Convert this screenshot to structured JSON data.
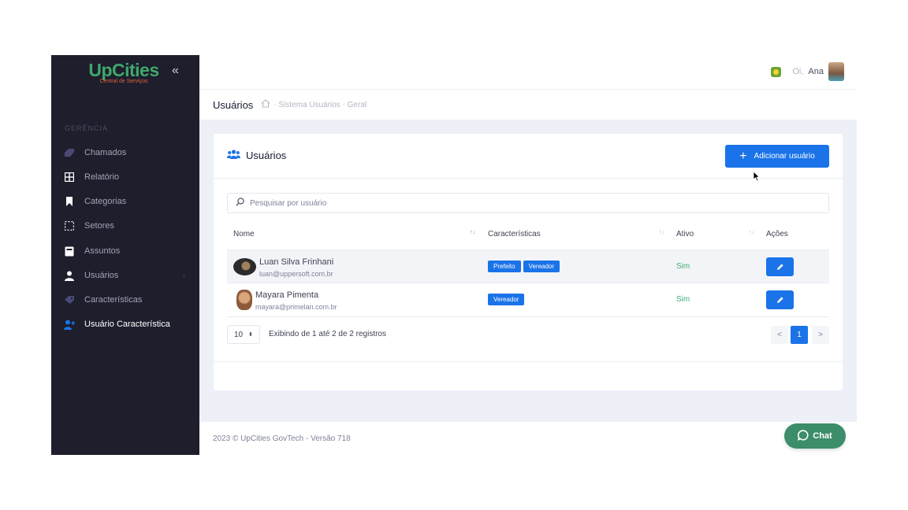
{
  "brand": {
    "title": "UpCities",
    "subtitle": "Central de Serviços"
  },
  "sidebar": {
    "section": "GERÊNCIA",
    "items": [
      {
        "label": "Chamados",
        "icon": "ticket-icon"
      },
      {
        "label": "Relatório",
        "icon": "grid-icon"
      },
      {
        "label": "Categorias",
        "icon": "bookmark-icon"
      },
      {
        "label": "Setores",
        "icon": "dotted-square-icon"
      },
      {
        "label": "Assuntos",
        "icon": "book-icon"
      },
      {
        "label": "Usuários",
        "icon": "user-icon",
        "arrow": "›"
      },
      {
        "label": "Características",
        "icon": "tag-icon"
      },
      {
        "label": "Usuário Característica",
        "icon": "user-plus-icon",
        "active": true
      }
    ]
  },
  "topbar": {
    "greeting": "Oi,",
    "user_name": "Ana"
  },
  "subheader": {
    "title": "Usuários",
    "breadcrumb": "· Sistema Usuários · Geral"
  },
  "card": {
    "title": "Usuários",
    "add_button": "Adicionar usuário",
    "search_placeholder": "Pesquisar por usuário",
    "columns": {
      "name": "Nome",
      "features": "Características",
      "active": "Ativo",
      "actions": "Ações"
    },
    "rows": [
      {
        "name": "Luan Silva Frinhani",
        "email": "luan@uppersoft.com.br",
        "badges": [
          "Prefeito",
          "Vereador"
        ],
        "active": "Sim"
      },
      {
        "name": "Mayara Pimenta",
        "email": "mayara@primelan.com.br",
        "badges": [
          "Vereador"
        ],
        "active": "Sim"
      }
    ],
    "page_size": "10",
    "info": "Exibindo de 1 até 2 de 2 registros",
    "pagination": {
      "prev": "<",
      "current": "1",
      "next": ">"
    }
  },
  "footer": {
    "text": "2023 © UpCities GovTech - Versão 718"
  },
  "chat": {
    "label": "Chat"
  },
  "colors": {
    "primary": "#1a73e8",
    "sidebar": "#1e1e2d",
    "brand_green": "#3fa86b",
    "chat": "#3c8d6a"
  }
}
